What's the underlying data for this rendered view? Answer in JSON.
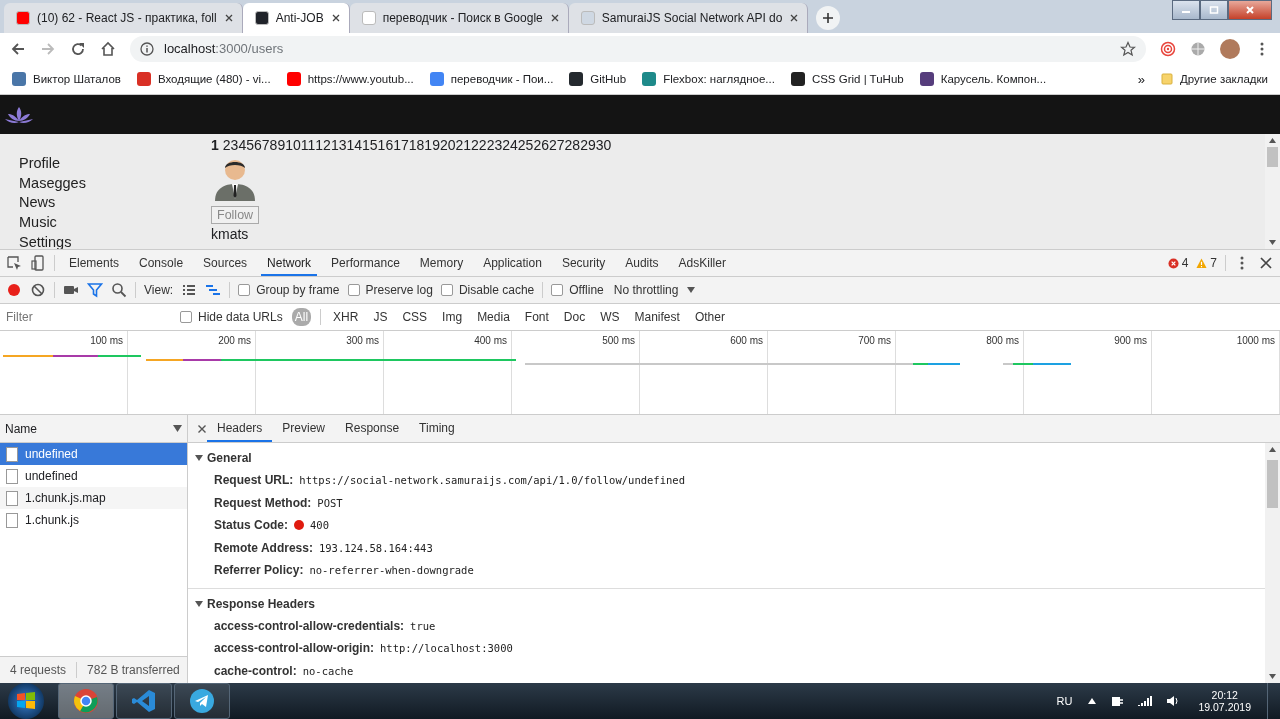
{
  "browser_tabs": [
    {
      "title": "(10) 62 - React JS - практика, foll",
      "selected": false
    },
    {
      "title": "Anti-JOB",
      "selected": true
    },
    {
      "title": "переводчик - Поиск в Google",
      "selected": false
    },
    {
      "title": "SamuraiJS Social Network API do",
      "selected": false
    }
  ],
  "address_bar": {
    "host": "localhost",
    "path": ":3000/users"
  },
  "bookmarks": [
    {
      "label": "Виктор Шаталов"
    },
    {
      "label": "Входящие (480) - vi..."
    },
    {
      "label": "https://www.youtub..."
    },
    {
      "label": "переводчик - Пои..."
    },
    {
      "label": "GitHub"
    },
    {
      "label": "Flexbox: наглядное..."
    },
    {
      "label": "CSS Grid | TuHub"
    },
    {
      "label": "Карусель. Компон..."
    }
  ],
  "bookmarks_more": "»",
  "other_bookmarks": "Другие закладки",
  "page": {
    "nav": [
      "Profile",
      "Masegges",
      "News",
      "Music",
      "Settings"
    ],
    "pages": [
      {
        "label": "1",
        "selected": true
      },
      {
        "label": "2",
        "selected": false
      },
      {
        "label": "3",
        "selected": false
      },
      {
        "label": "4",
        "selected": false
      },
      {
        "label": "5",
        "selected": false
      },
      {
        "label": "6",
        "selected": false
      },
      {
        "label": "7",
        "selected": false
      },
      {
        "label": "8",
        "selected": false
      },
      {
        "label": "9",
        "selected": false
      },
      {
        "label": "10",
        "selected": false
      },
      {
        "label": "11",
        "selected": false
      },
      {
        "label": "12",
        "selected": false
      },
      {
        "label": "13",
        "selected": false
      },
      {
        "label": "14",
        "selected": false
      },
      {
        "label": "15",
        "selected": false
      },
      {
        "label": "16",
        "selected": false
      },
      {
        "label": "17",
        "selected": false
      },
      {
        "label": "18",
        "selected": false
      },
      {
        "label": "19",
        "selected": false
      },
      {
        "label": "20",
        "selected": false
      },
      {
        "label": "21",
        "selected": false
      },
      {
        "label": "22",
        "selected": false
      },
      {
        "label": "23",
        "selected": false
      },
      {
        "label": "24",
        "selected": false
      },
      {
        "label": "25",
        "selected": false
      },
      {
        "label": "26",
        "selected": false
      },
      {
        "label": "27",
        "selected": false
      },
      {
        "label": "28",
        "selected": false
      },
      {
        "label": "29",
        "selected": false
      },
      {
        "label": "30",
        "selected": false
      }
    ],
    "users": [
      {
        "follow_button": "Follow",
        "disabled": true,
        "name": "kmats"
      }
    ]
  },
  "devtools": {
    "tabs": [
      {
        "label": "Elements",
        "selected": false
      },
      {
        "label": "Console",
        "selected": false
      },
      {
        "label": "Sources",
        "selected": false
      },
      {
        "label": "Network",
        "selected": true
      },
      {
        "label": "Performance",
        "selected": false
      },
      {
        "label": "Memory",
        "selected": false
      },
      {
        "label": "Application",
        "selected": false
      },
      {
        "label": "Security",
        "selected": false
      },
      {
        "label": "Audits",
        "selected": false
      },
      {
        "label": "AdsKiller",
        "selected": false
      }
    ],
    "errors": "4",
    "warnings": "7",
    "toolbar": {
      "recording": true,
      "view_label": "View:",
      "checkboxes": [
        {
          "label": "Group by frame",
          "checked": false
        },
        {
          "label": "Preserve log",
          "checked": false
        },
        {
          "label": "Disable cache",
          "checked": false
        },
        {
          "label": "Offline",
          "checked": false
        }
      ],
      "throttling": "No throttling"
    },
    "filter": {
      "placeholder": "Filter",
      "hide_data_urls": {
        "label": "Hide data URLs",
        "checked": false
      },
      "types": [
        {
          "label": "All",
          "selected": true
        },
        {
          "label": "XHR",
          "selected": false
        },
        {
          "label": "JS",
          "selected": false
        },
        {
          "label": "CSS",
          "selected": false
        },
        {
          "label": "Img",
          "selected": false
        },
        {
          "label": "Media",
          "selected": false
        },
        {
          "label": "Font",
          "selected": false
        },
        {
          "label": "Doc",
          "selected": false
        },
        {
          "label": "WS",
          "selected": false
        },
        {
          "label": "Manifest",
          "selected": false
        },
        {
          "label": "Other",
          "selected": false
        }
      ]
    },
    "timeline_ticks": [
      "100 ms",
      "200 ms",
      "300 ms",
      "400 ms",
      "500 ms",
      "600 ms",
      "700 ms",
      "800 ms",
      "900 ms",
      "1000 ms"
    ],
    "requests": {
      "column": "Name",
      "rows": [
        {
          "name": "undefined",
          "selected": true
        },
        {
          "name": "undefined",
          "selected": false
        },
        {
          "name": "1.chunk.js.map",
          "selected": false
        },
        {
          "name": "1.chunk.js",
          "selected": false
        }
      ],
      "summary": [
        "4 requests",
        "782 B transferred"
      ]
    },
    "details": {
      "tabs": [
        {
          "label": "Headers",
          "selected": true
        },
        {
          "label": "Preview",
          "selected": false
        },
        {
          "label": "Response",
          "selected": false
        },
        {
          "label": "Timing",
          "selected": false
        }
      ],
      "sections": [
        {
          "title": "General",
          "expanded": true,
          "headers": [
            {
              "name": "Request URL:",
              "value": "https://social-network.samuraijs.com/api/1.0/follow/undefined",
              "kind": "text"
            },
            {
              "name": "Request Method:",
              "value": "POST",
              "kind": "text"
            },
            {
              "name": "Status Code:",
              "value": "400",
              "kind": "status"
            },
            {
              "name": "Remote Address:",
              "value": "193.124.58.164:443",
              "kind": "text"
            },
            {
              "name": "Referrer Policy:",
              "value": "no-referrer-when-downgrade",
              "kind": "text"
            }
          ]
        },
        {
          "title": "Response Headers",
          "expanded": true,
          "headers": [
            {
              "name": "access-control-allow-credentials:",
              "value": "true",
              "kind": "text"
            },
            {
              "name": "access-control-allow-origin:",
              "value": "http://localhost:3000",
              "kind": "text"
            },
            {
              "name": "cache-control:",
              "value": "no-cache",
              "kind": "text"
            }
          ]
        }
      ]
    }
  },
  "taskbar": {
    "language": "RU",
    "time": "20:12",
    "date": "19.07.2019"
  }
}
